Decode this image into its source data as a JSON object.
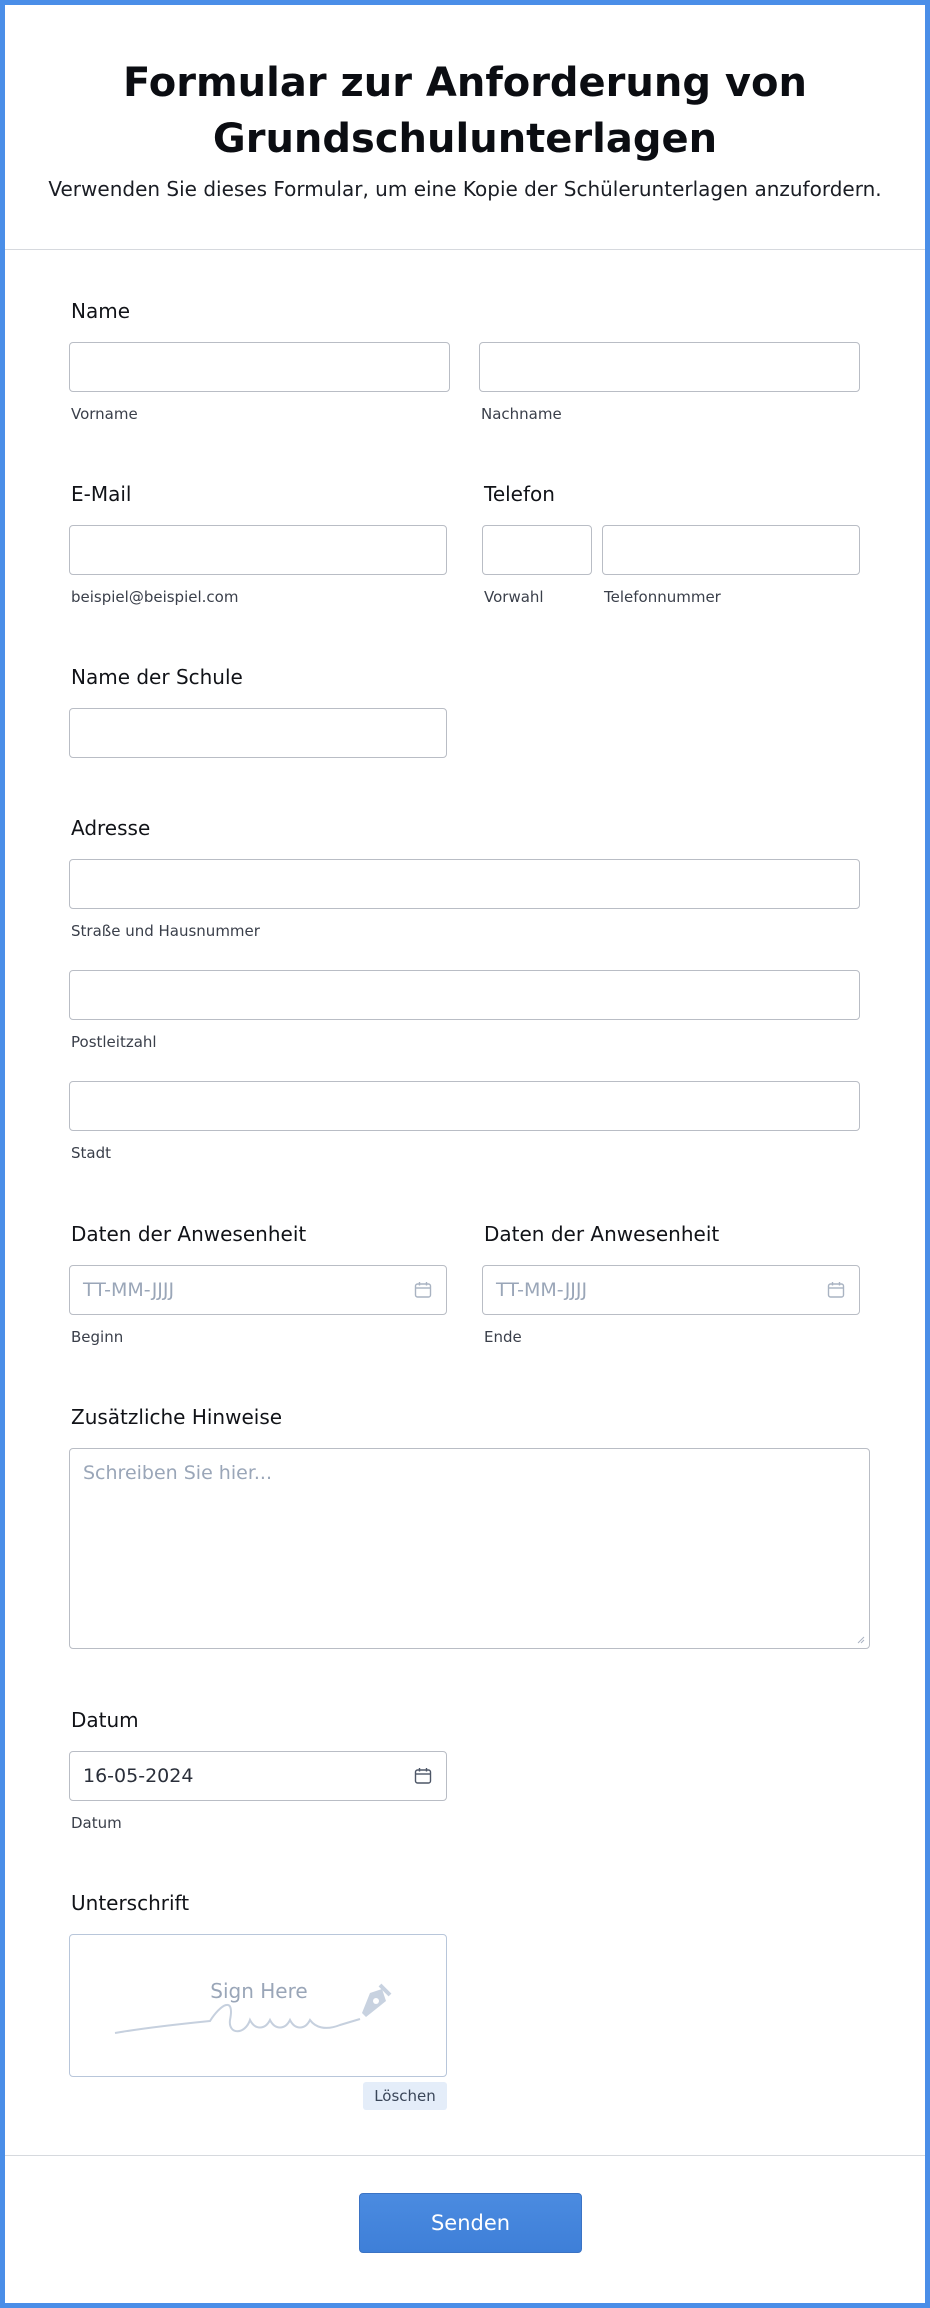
{
  "header": {
    "title_line1": "Formular zur Anforderung von",
    "title_line2": "Grundschulunterlagen",
    "subtitle": "Verwenden Sie dieses Formular, um eine Kopie der Schülerunterlagen anzufordern."
  },
  "name": {
    "label": "Name",
    "first_sub": "Vorname",
    "last_sub": "Nachname"
  },
  "email": {
    "label": "E-Mail",
    "sub": "beispiel@beispiel.com"
  },
  "phone": {
    "label": "Telefon",
    "area_sub": "Vorwahl",
    "number_sub": "Telefonnummer"
  },
  "school": {
    "label": "Name der Schule"
  },
  "address": {
    "label": "Adresse",
    "street_sub": "Straße und Hausnummer",
    "zip_sub": "Postleitzahl",
    "city_sub": "Stadt"
  },
  "attendance_start": {
    "label": "Daten der Anwesenheit",
    "placeholder": "TT-MM-JJJJ",
    "sub": "Beginn",
    "icon": "calendar-icon"
  },
  "attendance_end": {
    "label": "Daten der Anwesenheit",
    "placeholder": "TT-MM-JJJJ",
    "sub": "Ende",
    "icon": "calendar-icon"
  },
  "notes": {
    "label": "Zusätzliche Hinweise",
    "placeholder": "Schreiben Sie hier..."
  },
  "date": {
    "label": "Datum",
    "value": "16-05-2024",
    "sub": "Datum",
    "icon": "calendar-icon"
  },
  "signature": {
    "label": "Unterschrift",
    "prompt": "Sign Here",
    "clear_label": "Löschen",
    "icon": "pen-nib-icon"
  },
  "submit_label": "Senden",
  "colors": {
    "frame": "#4a8ee8",
    "button": "#4184dc",
    "placeholder": "#9aa6b8"
  }
}
